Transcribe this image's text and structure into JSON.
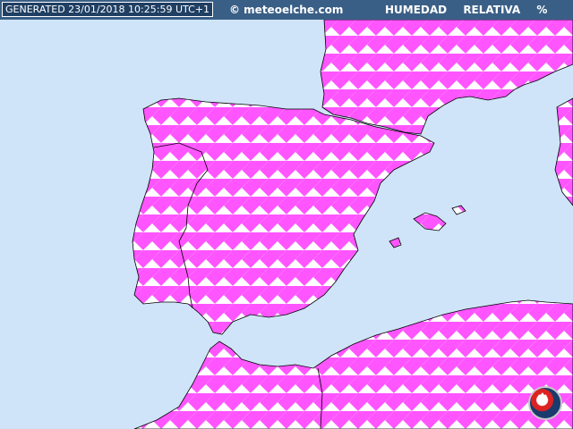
{
  "header": {
    "generated_label": "GENERATED 23/01/2018 10:25:59 UTC+1",
    "site": "© meteoelche.com",
    "field": "HUMEDAD RELATIVA %"
  },
  "colors": {
    "sea": "#cfe4f8",
    "land_fill_a": "#ff55ff",
    "land_fill_b": "#ffffff",
    "coastline": "#000000",
    "header_bg": "#3a5f86"
  },
  "logo": {
    "icon": "meteoelche-logo-icon",
    "glyph": "✱"
  }
}
